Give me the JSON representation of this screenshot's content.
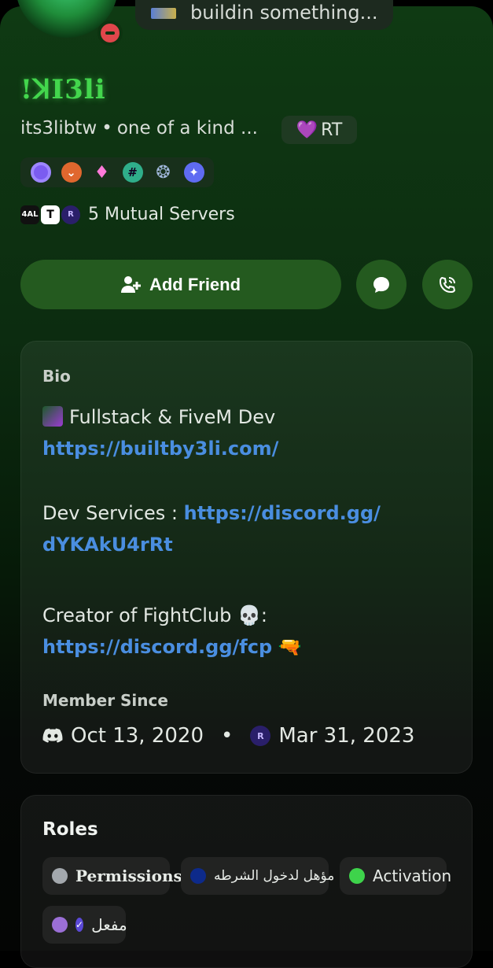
{
  "profile": {
    "status_text": "buildin something...",
    "display_name": "!ꓘI3li",
    "username": "its3libtw",
    "separator": "•",
    "tagline": "one of a kind ...",
    "tag_label": "RT",
    "mutual_servers": "5 Mutual Servers",
    "server_icons": [
      "4AL",
      "T",
      "R"
    ]
  },
  "actions": {
    "add_friend": "Add Friend"
  },
  "bio": {
    "label": "Bio",
    "line1_text": "Fullstack & FiveM Dev",
    "line1_link": "https://builtby3li.com/",
    "line2_prefix": "Dev Services : ",
    "line2_link_a": "https://discord.gg/",
    "line2_link_b": "dYKAkU4rRt",
    "line3_text": "Creator of FightClub 💀:",
    "line3_link": "https://discord.gg/fcp",
    "line3_emoji": "🔫"
  },
  "member_since": {
    "label": "Member Since",
    "discord_date": "Oct 13, 2020",
    "separator": "•",
    "server_date": "Mar 31, 2023"
  },
  "roles": {
    "title": "Roles",
    "items": [
      {
        "label": "Permissions",
        "color": "#a3a8ad"
      },
      {
        "label": "مؤهل لدخول الشرطه",
        "color": "#0d2a8a"
      },
      {
        "label": "Activation",
        "color": "#3ed34b"
      },
      {
        "label": "مفعل",
        "color": "#9b6fd6"
      }
    ]
  },
  "colors": {
    "accent_green": "#245a1f",
    "display_name": "#43d64d",
    "link": "#4a8ee0",
    "dnd_red": "#e0464b"
  }
}
